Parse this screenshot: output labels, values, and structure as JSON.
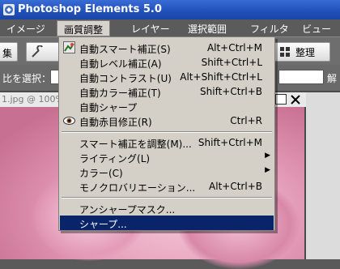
{
  "window": {
    "title": "Photoshop Elements 5.0"
  },
  "menubar": {
    "items": [
      {
        "label": "イメージ"
      },
      {
        "label": "画質調整"
      },
      {
        "label": "レイヤー"
      },
      {
        "label": "選択範囲"
      },
      {
        "label": "フィルタ"
      },
      {
        "label": "ビュー"
      }
    ]
  },
  "toolbar": {
    "left_label": "集",
    "right_label": "整理"
  },
  "options": {
    "label": "比を選択：",
    "right_label": "解"
  },
  "document": {
    "title": "1.jpg @ 100%"
  },
  "dropdown": {
    "items": [
      {
        "label": "自動スマート補正(S)",
        "shortcut": "Alt+Ctrl+M",
        "icon": "auto-smart-fix-icon"
      },
      {
        "label": "自動レベル補正(A)",
        "shortcut": "Shift+Ctrl+L"
      },
      {
        "label": "自動コントラスト(U)",
        "shortcut": "Alt+Shift+Ctrl+L"
      },
      {
        "label": "自動カラー補正(T)",
        "shortcut": "Shift+Ctrl+B"
      },
      {
        "label": "自動シャープ",
        "shortcut": ""
      },
      {
        "label": "自動赤目修正(R)",
        "shortcut": "Ctrl+R",
        "icon": "eye-icon"
      },
      {
        "label": "スマート補正を調整(M)...",
        "shortcut": "Shift+Ctrl+M"
      },
      {
        "label": "ライティング(L)",
        "shortcut": "",
        "submenu": true
      },
      {
        "label": "カラー(C)",
        "shortcut": "",
        "submenu": true
      },
      {
        "label": "モノクロバリエーション...",
        "shortcut": "Alt+Ctrl+B"
      },
      {
        "label": "アンシャープマスク...",
        "shortcut": ""
      },
      {
        "label": "シャープ...",
        "shortcut": "",
        "selected": true
      }
    ]
  },
  "colors": {
    "titlebar": "#1f4fb8",
    "menu_bg": "#d4d0c8",
    "menu_selected": "#0a246a"
  }
}
